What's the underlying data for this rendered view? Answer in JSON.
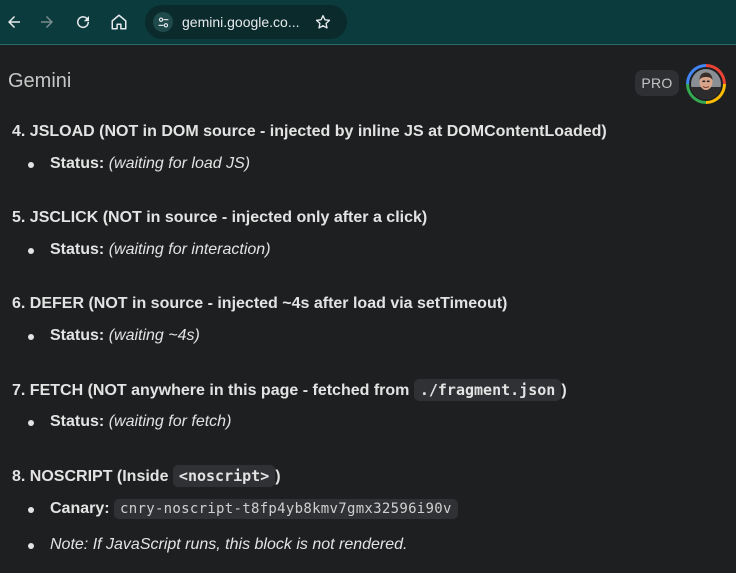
{
  "browser": {
    "url": "gemini.google.co...",
    "icons": [
      "back-arrow-icon",
      "forward-arrow-icon",
      "reload-icon",
      "home-icon",
      "site-tune-icon",
      "star-icon"
    ]
  },
  "app": {
    "title": "Gemini",
    "badge": "PRO"
  },
  "sections": [
    {
      "heading": "4. JSLOAD (NOT in DOM source - injected by inline JS at DOMContentLoaded)",
      "items": [
        {
          "label": "Status:",
          "value": "(waiting for load JS)"
        }
      ]
    },
    {
      "heading": "5. JSCLICK (NOT in source - injected only after a click)",
      "items": [
        {
          "label": "Status:",
          "value": "(waiting for interaction)"
        }
      ]
    },
    {
      "heading": "6. DEFER (NOT in source - injected ~4s after load via setTimeout)",
      "items": [
        {
          "label": "Status:",
          "value": "(waiting ~4s)"
        }
      ]
    },
    {
      "heading_prefix": "7. FETCH (NOT anywhere in this page - fetched from",
      "heading_code": "./fragment.json",
      "heading_suffix": ")",
      "items": [
        {
          "label": "Status:",
          "value": "(waiting for fetch)"
        }
      ]
    },
    {
      "heading_prefix": "8. NOSCRIPT (Inside",
      "heading_code": "<noscript>",
      "heading_suffix": ")",
      "items": [
        {
          "label": "Canary:",
          "code": "cnry-noscript-t8fp4yb8kmv7gmx32596i90v"
        },
        {
          "note": "Note: If JavaScript runs, this block is not rendered."
        }
      ]
    }
  ]
}
